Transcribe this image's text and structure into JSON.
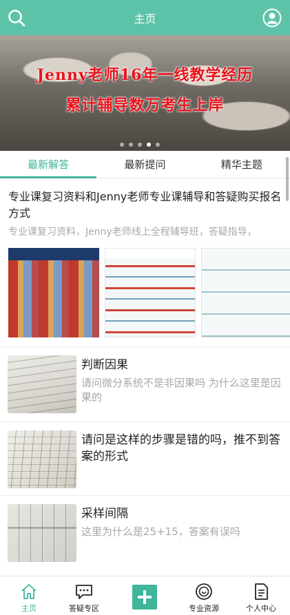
{
  "header": {
    "title": "主页"
  },
  "banner": {
    "line1": "Jenny老师16年一线教学经历",
    "line2": "累计辅导数万考生上岸",
    "dots": 5,
    "active_dot": 3
  },
  "tabs": [
    {
      "label": "最新解答",
      "active": true
    },
    {
      "label": "最新提问",
      "active": false
    },
    {
      "label": "精华主题",
      "active": false
    }
  ],
  "featured": {
    "title": "专业课复习资料和Jenny老师专业课辅导和答疑购买报名方式",
    "description": "专业课复习资料，Jenny老师线上全程辅导班，答疑指导，"
  },
  "list": [
    {
      "title": "判断因果",
      "subtitle": "请问微分系统不是非因果吗 为什么这里是因果的"
    },
    {
      "title": "请问是这样的步骤是错的吗，推不到答案的形式",
      "subtitle": ""
    },
    {
      "title": "采样间隔",
      "subtitle": "这里为什么是25+15，答案有误吗"
    }
  ],
  "bottom_nav": [
    {
      "label": "主页",
      "icon": "home-icon",
      "active": true
    },
    {
      "label": "答疑专区",
      "icon": "chat-icon",
      "active": false
    },
    {
      "label": "",
      "icon": "plus-icon",
      "active": false
    },
    {
      "label": "专业资源",
      "icon": "resource-icon",
      "active": false
    },
    {
      "label": "个人中心",
      "icon": "profile-icon",
      "active": false
    }
  ],
  "colors": {
    "accent": "#3fb59a",
    "header": "#5cc3a8",
    "banner_text": "#e8141b"
  }
}
